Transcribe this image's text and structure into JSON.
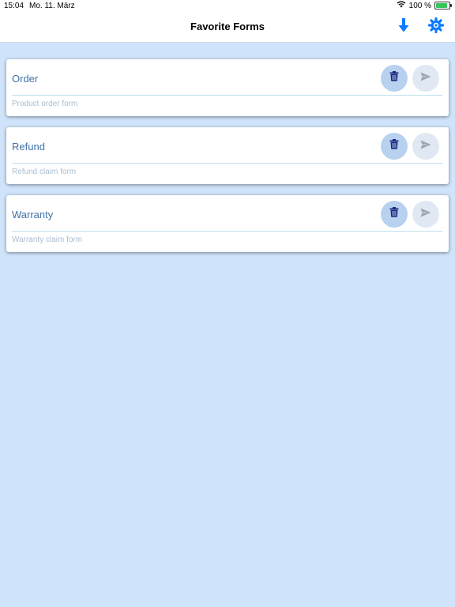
{
  "status_bar": {
    "time": "15:04",
    "date": "Mo. 11. März",
    "battery_text": "100 %",
    "battery_level": 100
  },
  "nav": {
    "title": "Favorite Forms",
    "download_icon": "arrow-down-icon",
    "settings_icon": "gear-icon",
    "accent_color": "#0a7aff"
  },
  "forms": [
    {
      "title": "Order",
      "subtitle": "Product order form"
    },
    {
      "title": "Refund",
      "subtitle": "Refund claim form"
    },
    {
      "title": "Warranty",
      "subtitle": "Warranty claim form"
    }
  ],
  "colors": {
    "background": "#cfe4fb",
    "card_title": "#3f72a8",
    "trash_icon": "#1a237e",
    "send_icon": "#9aa6b2"
  }
}
